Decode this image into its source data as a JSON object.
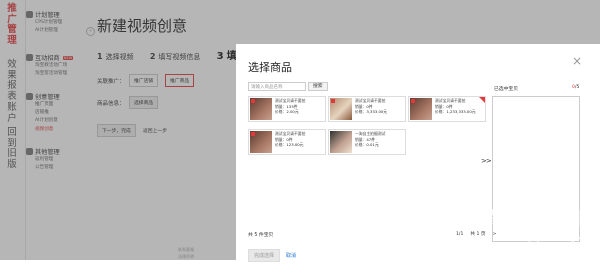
{
  "vnav": {
    "groups": [
      "推广管理",
      "效果报表",
      "账户",
      "回到旧版"
    ]
  },
  "sidebar": {
    "sections": [
      {
        "title": "计划管理",
        "subs": [
          "CPS计划管理",
          "AI计划管理"
        ]
      },
      {
        "title": "互动招商",
        "badge": "NEW",
        "subs": [
          "淘宝教活动广场",
          "淘宝客活动管理"
        ]
      },
      {
        "title": "创意管理",
        "subs": [
          "推广页面",
          "店铺推",
          "AI计划创意",
          "视频创意"
        ]
      },
      {
        "title": "其他管理",
        "subs": [
          "返利管理",
          "公告管理"
        ]
      }
    ],
    "collapse_glyph": "«"
  },
  "main": {
    "title": "新建视频创意",
    "steps": [
      {
        "num": "1",
        "label": "选择视频"
      },
      {
        "num": "2",
        "label": "填写视频信息"
      },
      {
        "num": "3",
        "label": "填写"
      }
    ],
    "promo_type_label": "关联推广：",
    "promo_options": [
      "推广店铺",
      "推广商品"
    ],
    "product_info_label": "商品信息：",
    "choose_product_btn": "选择商品",
    "next_btn": "下一步，完成",
    "back_link": "返回上一步",
    "footer_links": [
      "联系客服",
      "法律声明"
    ]
  },
  "modal": {
    "title": "选择商品",
    "close_glyph": "×",
    "search_placeholder": "请输入商品名称",
    "search_btn": "搜索",
    "products": [
      {
        "name": "测试宝贝请不要拍",
        "sales_label": "销量：",
        "sales": "133件",
        "price_label": "价格：",
        "price": "2.00元"
      },
      {
        "name": "测试宝贝请不要拍",
        "sales_label": "销量：",
        "sales": "0件",
        "price_label": "价格：",
        "price": "3,333.00元"
      },
      {
        "name": "测试宝贝请不要拍",
        "sales_label": "销量：",
        "sales": "0件",
        "price_label": "价格：",
        "price": "1,233,333.00元"
      },
      {
        "name": "测试宝贝请不要拍",
        "sales_label": "销量：",
        "sales": "0件",
        "price_label": "价格：",
        "price": "123.00元"
      },
      {
        "name": "一淘自主拍摄测试",
        "sales_label": "销量：",
        "sales": "47件",
        "price_label": "价格：",
        "price": "0.01元"
      }
    ],
    "move_glyph": ">>",
    "selected_title": "已选中宝贝",
    "selected_count": "0",
    "selected_max": "/5",
    "total": "共 5 件宝贝",
    "page_current": "1/1",
    "page_total": "共 1 页",
    "page_arrow": ">",
    "ok_btn": "完成选择",
    "cancel_btn": "取消",
    "colors": {
      "accent": "#e4393c",
      "link": "#1a6fd0"
    }
  },
  "watermark": {
    "line1": "货源批发网",
    "line2": "6pf.cn",
    "line3": "bbs.taobao.com"
  }
}
